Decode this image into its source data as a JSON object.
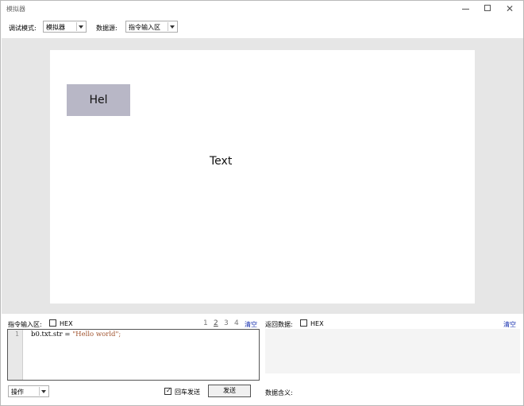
{
  "window": {
    "title": "模拟器",
    "minimize_glyph": "",
    "close_glyph": "✕"
  },
  "toolbar": {
    "mode_label": "调试模式:",
    "mode_value": "模拟器",
    "source_label": "数据源:",
    "source_value": "指令输入区"
  },
  "stage": {
    "button_text": "Hel",
    "text_label": "Text",
    "button_color": "#b8b7c6"
  },
  "command": {
    "label": "指令输入区:",
    "hex_label": "HEX",
    "hex_checked": false,
    "pages": [
      "1",
      "2",
      "3",
      "4"
    ],
    "active_page": "2",
    "clear": "清空",
    "line_number": "1",
    "code_prefix": "b0.txt.str = ",
    "code_string": "\"Hello world\";"
  },
  "result": {
    "label": "返回数据:",
    "hex_label": "HEX",
    "hex_checked": false,
    "clear": "清空",
    "meaning_label": "数据含义:"
  },
  "footer": {
    "action_value": "操作",
    "enter_send_label": "回车发送",
    "enter_send_checked": true,
    "send_label": "发送"
  },
  "colors": {
    "link": "#1a33b0",
    "stage_bg": "#e6e6e6",
    "string_literal": "#a0522d"
  }
}
